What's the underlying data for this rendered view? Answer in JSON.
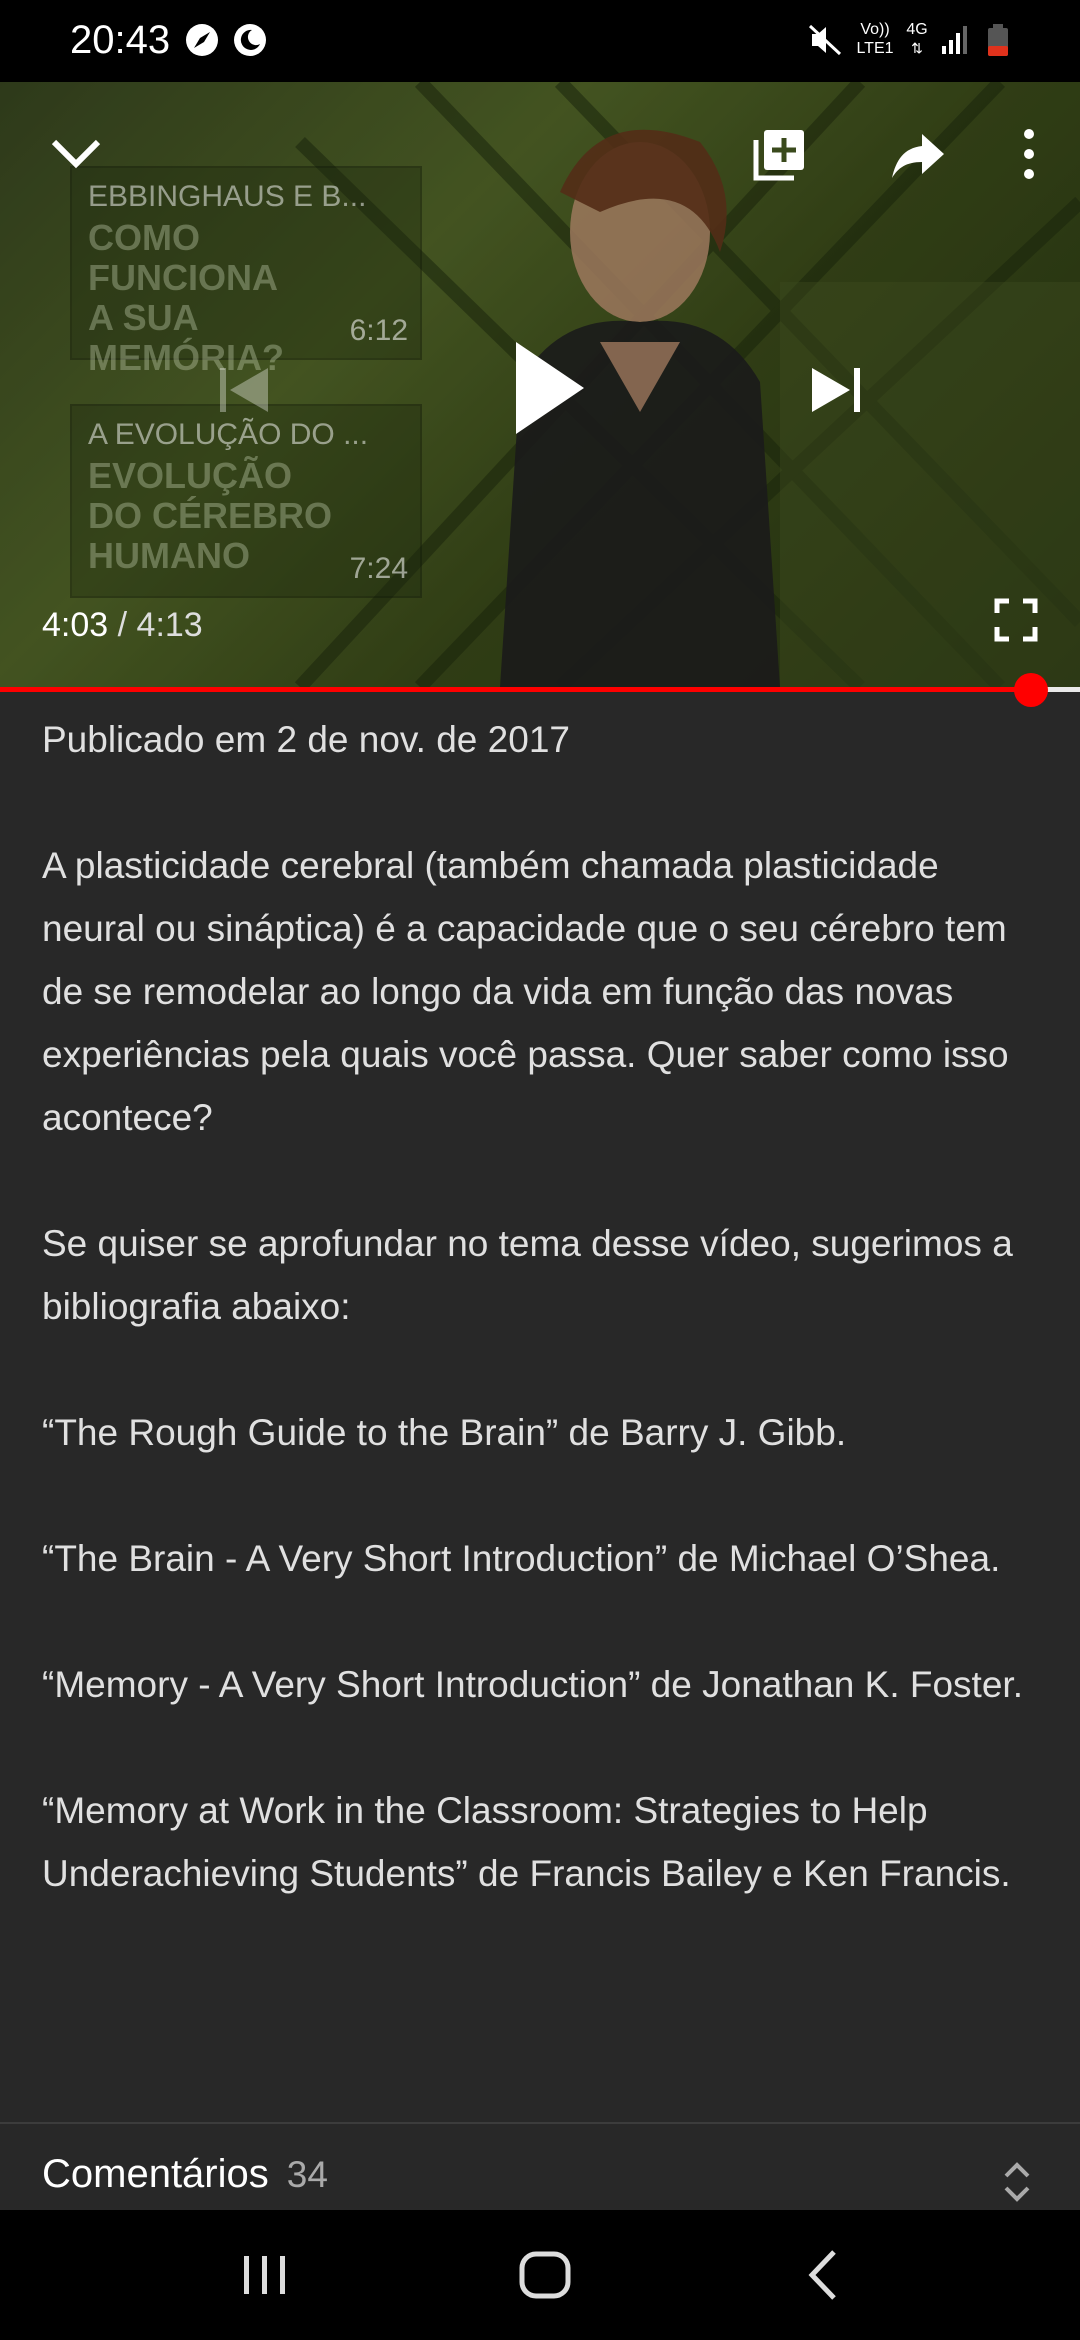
{
  "status_bar": {
    "time": "20:43",
    "network_label_top": "Vo))",
    "network_label_bottom": "LTE1",
    "network_type": "4G",
    "icons": [
      "compass-icon",
      "moon-icon",
      "mute-icon",
      "signal-icon",
      "battery-icon"
    ]
  },
  "player": {
    "current_time": "4:03",
    "separator": " / ",
    "total_time": "4:13",
    "progress_fraction": 0.955,
    "recommendations": [
      {
        "title": "EBBINGHAUS E B...",
        "duration": "6:12",
        "thumb_text": [
          "COMO",
          "FUNCIONA",
          "A SUA",
          "MEMÓRIA?"
        ]
      },
      {
        "title": "A EVOLUÇÃO DO ...",
        "duration": "7:24",
        "thumb_text": [
          "EVOLUÇÃO",
          "DO CÉREBRO",
          "HUMANO"
        ]
      }
    ],
    "icons": [
      "collapse-chevron-icon",
      "add-to-playlist-icon",
      "share-icon",
      "more-vert-icon",
      "previous-icon",
      "play-icon",
      "next-icon",
      "fullscreen-icon"
    ],
    "accent_color": "#ff0000"
  },
  "description": {
    "published": "Publicado em 2 de nov. de 2017",
    "paragraphs": [
      "A plasticidade cerebral (também chamada plasticidade neural ou sináptica) é a capacidade que o seu cérebro tem de se remodelar ao longo da vida em função das novas experiências pela quais você passa. Quer saber como isso acontece?",
      "Se quiser se aprofundar no tema desse vídeo, sugerimos a bibliografia abaixo:",
      "“The Rough Guide to the Brain” de Barry J. Gibb.",
      "“The Brain - A Very Short Introduction” de Michael O’Shea.",
      "“Memory - A Very Short Introduction” de Jonathan K. Foster.",
      "“Memory at Work in the Classroom: Strategies to Help Underachieving Students” de Francis Bailey e Ken Francis."
    ]
  },
  "comments": {
    "label": "Comentários",
    "count": "34"
  },
  "nav_bar": {
    "icons": [
      "recent-apps-icon",
      "home-icon",
      "back-icon"
    ]
  }
}
